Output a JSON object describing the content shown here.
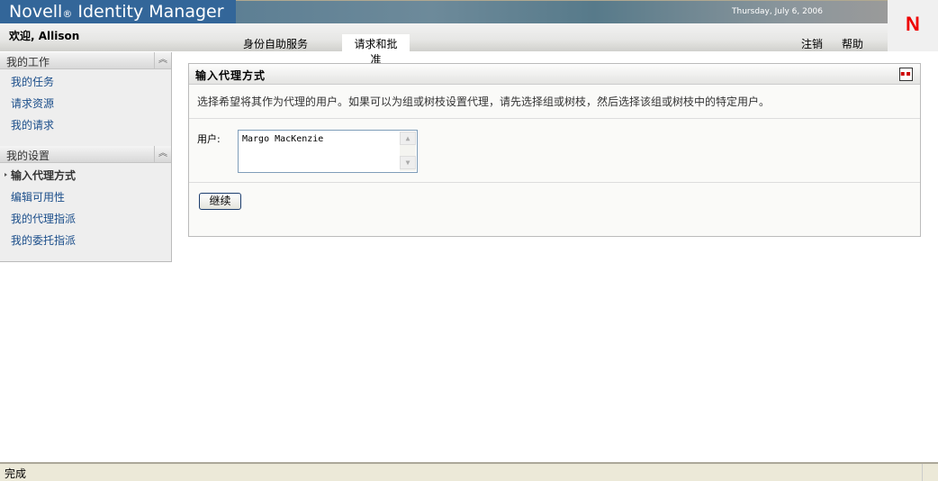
{
  "header": {
    "product": "Novell",
    "reg": "®",
    "title": "Identity Manager",
    "date": "Thursday, July 6, 2006",
    "logo": "N",
    "welcome": "欢迎, Allison"
  },
  "tabs": [
    {
      "label": "身份自助服务",
      "active": false
    },
    {
      "label": "请求和批准",
      "active": true
    }
  ],
  "top_links": {
    "logout": "注销",
    "help": "帮助"
  },
  "sidebar": {
    "sections": [
      {
        "title": "我的工作",
        "items": [
          "我的任务",
          "请求资源",
          "我的请求"
        ]
      },
      {
        "title": "我的设置",
        "items": [
          "输入代理方式",
          "编辑可用性",
          "我的代理指派",
          "我的委托指派"
        ],
        "current": 0
      }
    ]
  },
  "panel": {
    "title": "输入代理方式",
    "description": "选择希望将其作为代理的用户。如果可以为组或树枝设置代理，请先选择组或树枝，然后选择该组或树枝中的特定用户。",
    "user_label": "用户:",
    "user_value": "Margo MacKenzie",
    "continue_label": "继续"
  },
  "status": {
    "text": "完成"
  }
}
